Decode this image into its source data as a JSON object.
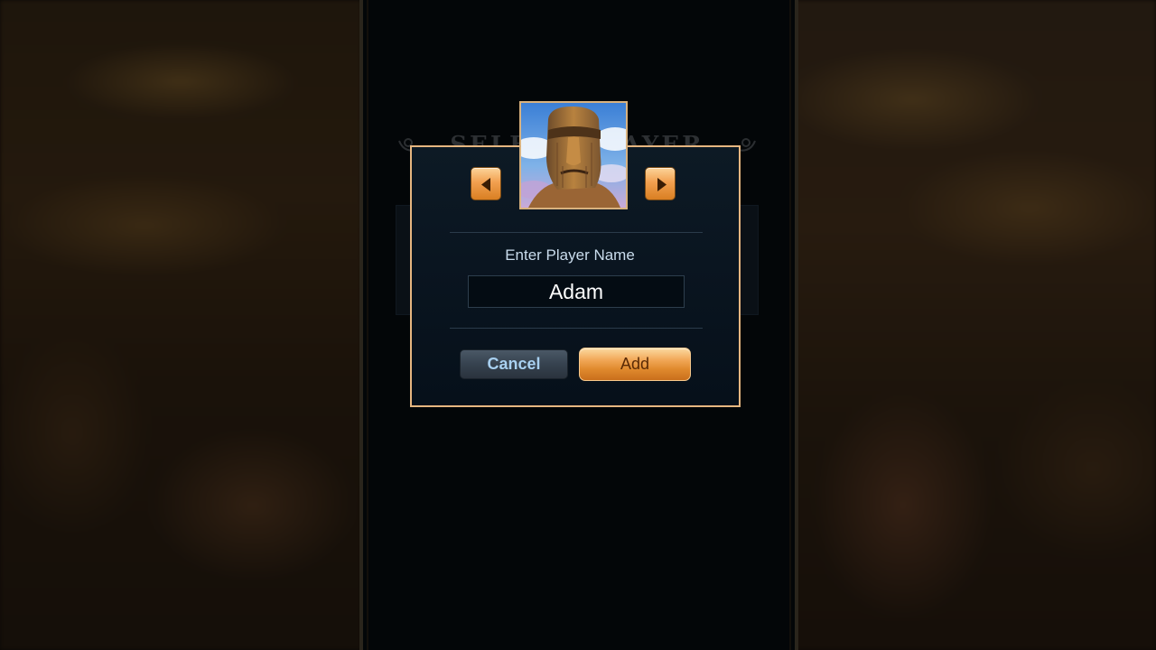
{
  "background": {
    "side_tone": "#1e160c",
    "center_tone": "#030608"
  },
  "under_screen": {
    "title": "SELECT PLAYER"
  },
  "dialog": {
    "border_color": "#e6b680",
    "avatar": {
      "icon": "moai-statue-avatar",
      "prev_icon": "arrow-left-icon",
      "next_icon": "arrow-right-icon"
    },
    "prompt_label": "Enter Player Name",
    "name_value": "Adam",
    "cancel_label": "Cancel",
    "add_label": "Add"
  },
  "colors": {
    "accent_orange": "#f2a95a",
    "cancel_text": "#a8d0f0",
    "label_text": "#c9dcec"
  }
}
